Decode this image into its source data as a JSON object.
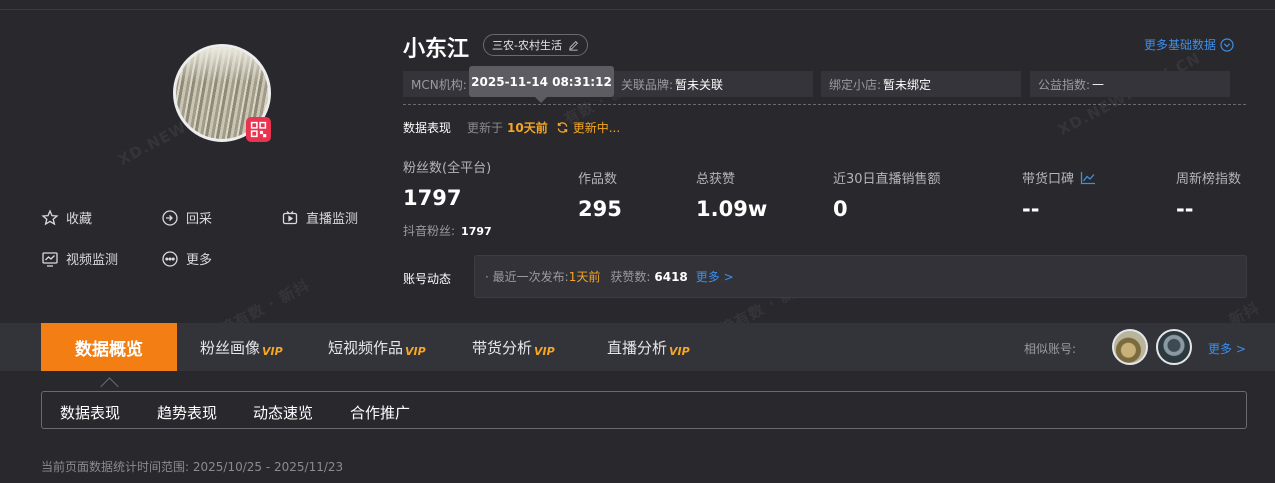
{
  "profile": {
    "name": "小东江",
    "category": "三农-农村生活",
    "more_basic": "更多基础数据",
    "actions": {
      "favorite": "收藏",
      "collect": "回采",
      "live_monitor": "直播监测",
      "video_monitor": "视频监测",
      "more": "更多"
    }
  },
  "fields": {
    "mcn_label": "MCN机构:",
    "tooltip": "2025-11-14 08:31:12",
    "brand_label": "关联品牌:",
    "brand_value": "暂未关联",
    "shop_label": "绑定小店:",
    "shop_value": "暂未绑定",
    "charity_label": "公益指数:",
    "charity_value": "—"
  },
  "performance": {
    "title": "数据表现",
    "updated_prefix": "更新于",
    "updated_ago": "10天前",
    "updating": "更新中..."
  },
  "stats": {
    "fans_label": "粉丝数(全平台)",
    "fans_value": "1797",
    "douyin_fans_label": "抖音粉丝:",
    "douyin_fans_value": "1797",
    "works_label": "作品数",
    "works_value": "295",
    "likes_label": "总获赞",
    "likes_value": "1.09w",
    "live_sales_label": "近30日直播销售额",
    "live_sales_value": "0",
    "reputation_label": "带货口碑",
    "reputation_value": "--",
    "weekly_label": "周新榜指数",
    "weekly_value": "--"
  },
  "dynamics": {
    "label": "账号动态",
    "last_post_label": "· 最近一次发布:",
    "last_post_value": "1天前",
    "likes_label": "获赞数:",
    "likes_value": "6418",
    "more": "更多 >"
  },
  "tabs": {
    "overview": "数据概览",
    "fans": "粉丝画像",
    "videos": "短视频作品",
    "goods": "带货分析",
    "live": "直播分析",
    "vip": "VIP",
    "similar_label": "相似账号:",
    "similar_more": "更多 >"
  },
  "subtabs": [
    "数据表现",
    "趋势表现",
    "动态速览",
    "合作推广"
  ],
  "range": "当前页面数据统计时间范围: 2025/10/25 - 2025/11/23",
  "watermarks": [
    "XD.NEWRANK.CN",
    "XD.NEWRANK.CN",
    "新榜有数 · 新抖",
    "新榜有数 · 新抖",
    "有数 · 新抖",
    "有数 · 新抖"
  ],
  "colors": {
    "accent": "#f37e14",
    "link": "#3f8fe8",
    "highlight": "#f5a623",
    "background": "#28282d"
  }
}
